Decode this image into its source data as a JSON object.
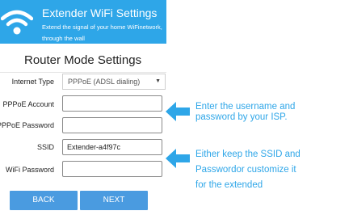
{
  "header": {
    "title": "Extender WiFi Settings",
    "subtitle": "Extend the signal of your home WiFinetwork, through the wall"
  },
  "section_title": "Router Mode Settings",
  "form": {
    "internet_type": {
      "label": "Internet Type",
      "value": "PPPoE (ADSL dialing)"
    },
    "pppoe_account": {
      "label": "PPPoE Account",
      "value": ""
    },
    "pppoe_password": {
      "label": "PPPoE Password",
      "value": ""
    },
    "ssid": {
      "label": "SSID",
      "value": "Extender-a4f97c"
    },
    "wifi_password": {
      "label": "WiFi Password",
      "value": ""
    }
  },
  "buttons": {
    "back": "BACK",
    "next": "NEXT"
  },
  "notes": {
    "note1_line1": "Enter the username and",
    "note1_line2": "password  by your ISP.",
    "note2_line1": "Either keep the SSID and",
    "note2_line2": "Passwordor customize it",
    "note2_line3": "for the extended"
  },
  "colors": {
    "accent": "#2ea6e8",
    "button": "#4a9be0"
  },
  "icons": [
    "wifi-icon",
    "left-arrow-icon"
  ]
}
